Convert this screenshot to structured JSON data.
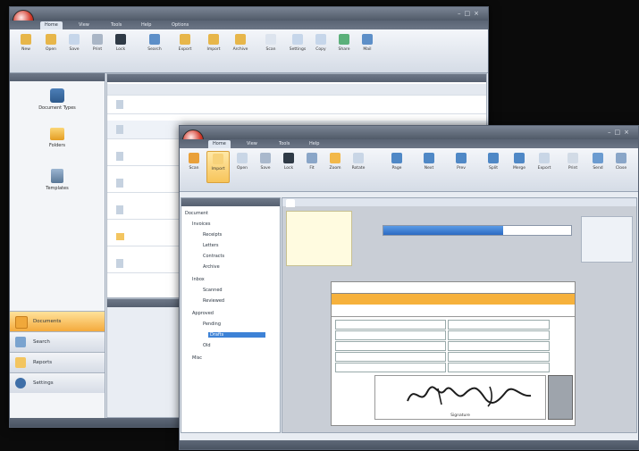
{
  "back_window": {
    "title": "",
    "tabs": [
      "Home",
      "View",
      "Tools",
      "Help",
      "Options"
    ],
    "ribbon_labels": [
      "New",
      "Open",
      "Save",
      "Print",
      "Lock",
      "Search",
      "Export",
      "Import",
      "Archive",
      "Scan",
      "Settings",
      "Copy",
      "Share",
      "Mail"
    ],
    "left_panel": {
      "header": "",
      "items": [
        "Document Types",
        "Folders",
        "Templates"
      ],
      "nav": [
        "Documents",
        "Search",
        "Reports",
        "Settings"
      ]
    },
    "grid_header": "",
    "columns": [
      "",
      "",
      "",
      "",
      "",
      "",
      "",
      "",
      ""
    ],
    "status": ""
  },
  "front_window": {
    "title": "",
    "tabs": [
      "Home",
      "View",
      "Tools",
      "Help"
    ],
    "ribbon_labels": [
      "Scan",
      "Import",
      "Open",
      "Save",
      "Lock",
      "Fit",
      "Zoom",
      "Rotate",
      "Page",
      "Next",
      "Prev",
      "Split",
      "Merge",
      "Export",
      "Print",
      "Send",
      "Close"
    ],
    "tree_header": "",
    "tree_nodes": [
      "Document",
      "Invoices",
      "Receipts",
      "Letters",
      "Contracts",
      "Archive",
      "Inbox",
      "Scanned",
      "Reviewed",
      "Approved",
      "Pending",
      "Drafts",
      "Old",
      "Misc"
    ],
    "doc_tab": "",
    "doc_form_title": "",
    "signature_text": "Signature",
    "status": ""
  },
  "colors": {
    "accent": "#f6b13c",
    "selection": "#3d82d6",
    "chrome_dark": "#505a68"
  },
  "icons": [
    "app-orb-icon",
    "minimize-icon",
    "maximize-icon",
    "close-icon",
    "folder-icon",
    "document-icon",
    "scanner-icon",
    "printer-icon",
    "lock-icon"
  ]
}
